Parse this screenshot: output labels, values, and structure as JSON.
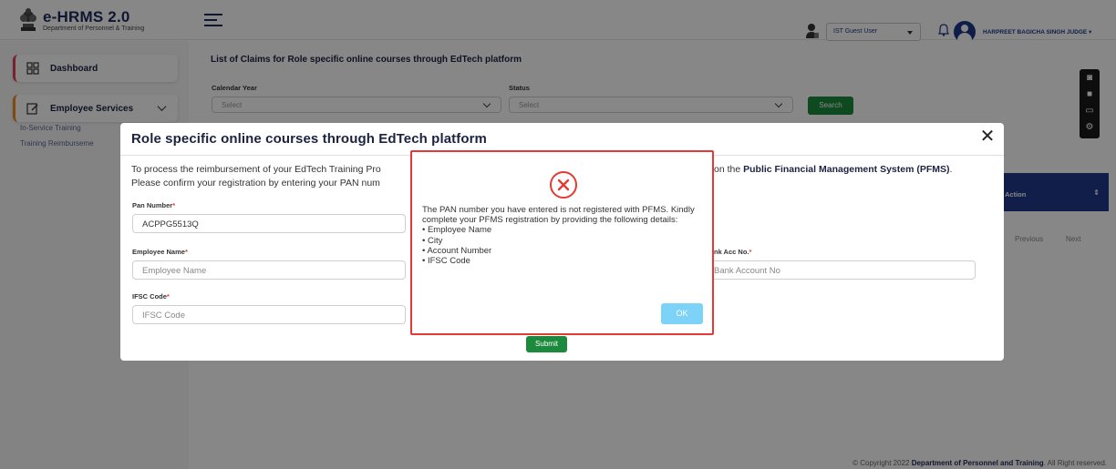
{
  "app": {
    "title": "e-HRMS 2.0",
    "subtitle": "Department of Personnel & Training",
    "role": "IST Guest User",
    "user_name": "HARPREET BAGICHA SINGH JUDGE"
  },
  "sidebar": {
    "items": [
      {
        "label": "Dashboard",
        "icon": "grid-icon"
      },
      {
        "label": "Employee Services",
        "icon": "edit-icon"
      }
    ],
    "subitems": [
      "In-Service Training",
      "Training Reimburseme"
    ]
  },
  "page": {
    "title": "List of Claims for Role specific online courses through EdTech platform",
    "calendar_year_label": "Calendar Year",
    "calendar_year_placeholder": "Select",
    "status_label": "Status",
    "status_placeholder": "Select",
    "search_label": "Search",
    "table_action_header": "Action",
    "prev_label": "Previous",
    "next_label": "Next",
    "submit_label": "Submit"
  },
  "modal": {
    "title": "Role specific online courses through EdTech platform",
    "intro_line1_part1": "To process the reimbursement of your EdTech Training Pro",
    "intro_line1_part2": "on the ",
    "intro_line1_bold": "Public Financial Management System (PFMS)",
    "intro_line1_end": ".",
    "intro_line2": "Please confirm your registration by entering your PAN num",
    "pan_label": "Pan Number",
    "pan_value": "ACPPG5513Q",
    "employee_name_label": "Employee Name",
    "employee_name_placeholder": "Employee Name",
    "bank_acc_label": "nk Acc No.",
    "bank_acc_placeholder": "Bank Account No",
    "ifsc_label": "IFSC Code",
    "ifsc_placeholder": "IFSC Code",
    "required_mark": "*"
  },
  "alert": {
    "message": "The PAN number you have entered is not registered with PFMS. Kindly complete your PFMS registration by providing the following details:",
    "items": [
      "Employee Name",
      "City",
      "Account Number",
      "IFSC Code"
    ],
    "ok_label": "OK"
  },
  "footer": {
    "text_prefix": "© Copyright 2022 ",
    "text_bold": "Department of Personnel and Training",
    "text_suffix": ". All Right reserved."
  },
  "colors": {
    "primary_navy": "#1e2a5a",
    "table_header": "#223a8c",
    "button_green": "#1c8a3c",
    "alert_red": "#e53935",
    "ok_blue": "#7dd3f7"
  }
}
